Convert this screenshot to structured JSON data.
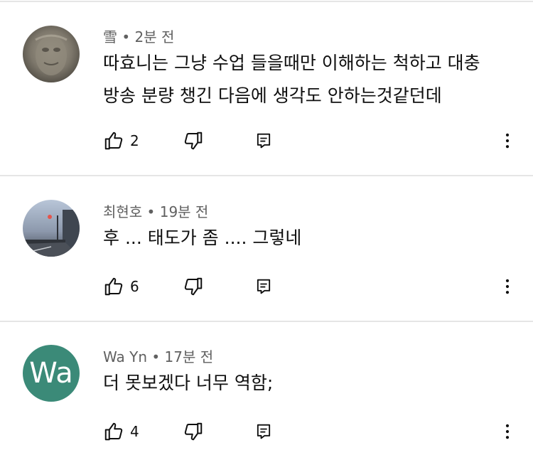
{
  "comments": [
    {
      "author": "雪",
      "time": "2분 전",
      "text_lines": [
        "따효니는 그냥 수업 들을때만 이해하는 척하고 대충",
        "방송 분량 챙긴 다음에 생각도 안하는것같던데"
      ],
      "likes": "2",
      "avatar_type": "photo-stone"
    },
    {
      "author": "최현호",
      "time": "19분 전",
      "text_lines": [
        "후 ...  태도가 좀 .... 그렇네"
      ],
      "likes": "6",
      "avatar_type": "photo-street"
    },
    {
      "author": "Wa Yn",
      "time": "17분 전",
      "text_lines": [
        "더 못보겠다 너무 역함;"
      ],
      "likes": "4",
      "avatar_type": "letter",
      "avatar_letters": "Wa",
      "avatar_color": "#3b8a78"
    }
  ],
  "separator": " • ",
  "icons": {
    "like": "thumb-up-icon",
    "dislike": "thumb-down-icon",
    "reply": "reply-icon",
    "more": "more-vert-icon"
  }
}
